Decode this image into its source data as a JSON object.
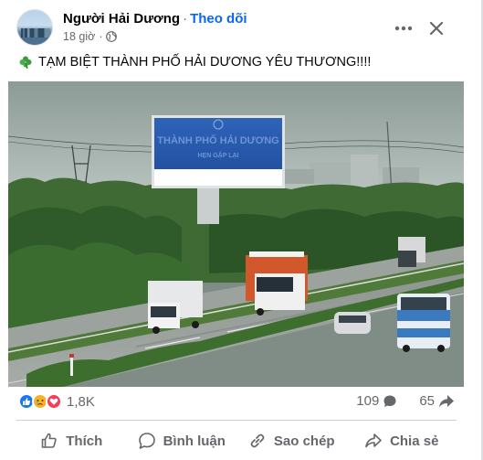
{
  "post": {
    "page_name": "Người Hải Dương",
    "separator": "·",
    "follow_label": "Theo dõi",
    "time": "18 giờ",
    "time_sep": "·",
    "caption": "TẠM BIỆT THÀNH PHỐ HẢI DƯƠNG YÊU THƯƠNG!!!!",
    "billboard_text": "THÀNH PHỐ HẢI DƯƠNG",
    "billboard_subtext": "HẸN GẶP LẠI"
  },
  "stats": {
    "reaction_count": "1,8K",
    "comment_count": "109",
    "share_count": "65",
    "reaction_icons": [
      "like-icon",
      "sad-icon",
      "love-icon"
    ],
    "colors": {
      "like": "#1877f2",
      "sad": "#f7b125",
      "love": "#f33e58"
    }
  },
  "actions": {
    "like": "Thích",
    "comment": "Bình luận",
    "copy": "Sao chép",
    "share": "Chia sẻ"
  },
  "colors": {
    "follow": "#0866ff",
    "muted": "#65676b",
    "text": "#050505"
  }
}
